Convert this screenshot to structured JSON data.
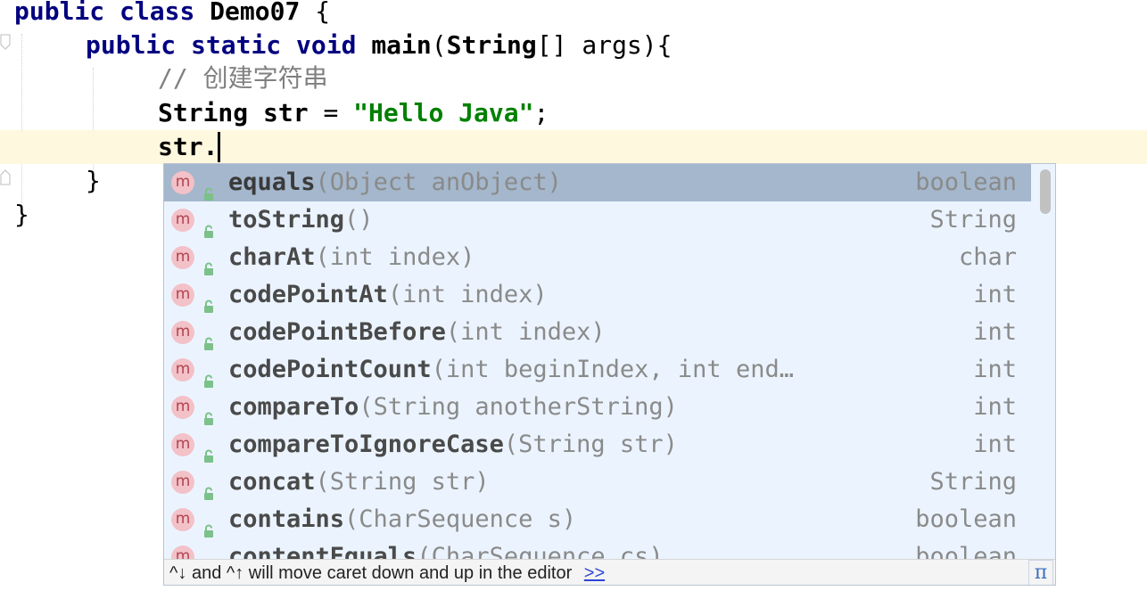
{
  "editor": {
    "line1": {
      "k1": "public",
      "k2": "class",
      "name": "Demo07",
      "brace": "{"
    },
    "line2": {
      "k1": "public",
      "k2": "static",
      "k3": "void",
      "method": "main",
      "open": "(",
      "type": "String",
      "rest": "[] args){"
    },
    "line3": {
      "comment": "// 创建字符串"
    },
    "line4": {
      "type": "String",
      "var": "str",
      "eq": "=",
      "literal": "\"Hello Java\"",
      "semi": ";"
    },
    "line5": {
      "text": "str."
    },
    "line6": {
      "text": "}"
    },
    "line7": {
      "text": "}"
    }
  },
  "completion": {
    "items": [
      {
        "icon": "m",
        "name": "equals",
        "params": "(Object anObject)",
        "type": "boolean"
      },
      {
        "icon": "m",
        "name": "toString",
        "params": "()",
        "type": "String"
      },
      {
        "icon": "m",
        "name": "charAt",
        "params": "(int index)",
        "type": "char"
      },
      {
        "icon": "m",
        "name": "codePointAt",
        "params": "(int index)",
        "type": "int"
      },
      {
        "icon": "m",
        "name": "codePointBefore",
        "params": "(int index)",
        "type": "int"
      },
      {
        "icon": "m",
        "name": "codePointCount",
        "params": "(int beginIndex, int end…",
        "type": "int"
      },
      {
        "icon": "m",
        "name": "compareTo",
        "params": "(String anotherString)",
        "type": "int"
      },
      {
        "icon": "m",
        "name": "compareToIgnoreCase",
        "params": "(String str)",
        "type": "int"
      },
      {
        "icon": "m",
        "name": "concat",
        "params": "(String str)",
        "type": "String"
      },
      {
        "icon": "m",
        "name": "contains",
        "params": "(CharSequence s)",
        "type": "boolean"
      },
      {
        "icon": "m",
        "name": "contentEquals",
        "params": "(CharSequence cs)",
        "type": "boolean"
      }
    ],
    "status_text": "^↓ and ^↑ will move caret down and up in the editor",
    "status_link": ">>",
    "pi_label": "π"
  }
}
